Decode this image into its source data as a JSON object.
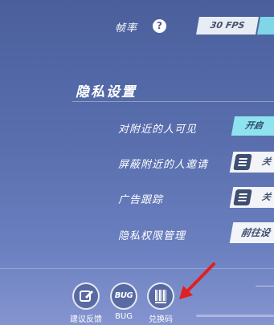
{
  "frame_rate": {
    "label": "帧率",
    "help_icon": "?",
    "selected_option": "30 FPS"
  },
  "privacy": {
    "section_title": "隐私设置",
    "settings": [
      {
        "label": "对附近的人可见",
        "state": "开启"
      },
      {
        "label": "屏蔽附近的人邀请",
        "state": "关"
      },
      {
        "label": "广告跟踪",
        "state": "关"
      },
      {
        "label": "隐私权限管理",
        "state": "前往设"
      }
    ]
  },
  "bottom_bar": {
    "feedback_label": "建议反馈",
    "bug_label": "BUG",
    "bug_icon_text": "BUG",
    "redeem_label": "兑换码",
    "redeem_icon_text": "兑换码"
  },
  "colors": {
    "accent_on": "#8ee3ef",
    "background_top": "#4a5f9c",
    "arrow_red": "#e02020"
  }
}
